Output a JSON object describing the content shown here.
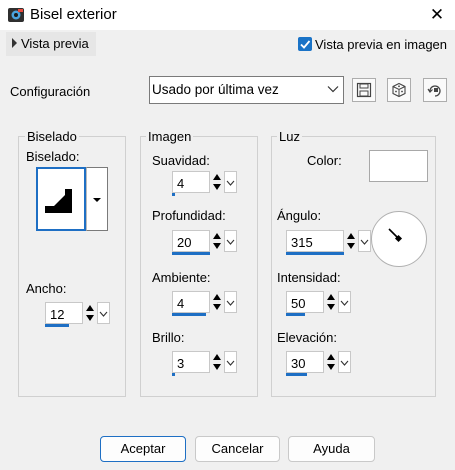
{
  "window": {
    "title": "Bisel exterior",
    "close_glyph": "✕"
  },
  "header": {
    "preview_toggle_label": "Vista previa",
    "preview_in_image_label": "Vista previa en imagen",
    "preview_in_image_checked": true
  },
  "config": {
    "label": "Configuración",
    "preset_value": "Usado por última vez"
  },
  "bevel": {
    "legend": "Biselado",
    "bevel_label": "Biselado:",
    "width_label": "Ancho:",
    "width_value": "12"
  },
  "image": {
    "legend": "Imagen",
    "smoothness_label": "Suavidad:",
    "smoothness_value": "4",
    "depth_label": "Profundidad:",
    "depth_value": "20",
    "ambience_label": "Ambiente:",
    "ambience_value": "4",
    "shininess_label": "Brillo:",
    "shininess_value": "3"
  },
  "light": {
    "legend": "Luz",
    "color_label": "Color:",
    "color_value": "#ffffff",
    "angle_label": "Ángulo:",
    "angle_value": "315",
    "intensity_label": "Intensidad:",
    "intensity_value": "50",
    "elevation_label": "Elevación:",
    "elevation_value": "30"
  },
  "footer": {
    "ok_label": "Aceptar",
    "cancel_label": "Cancelar",
    "help_label": "Ayuda"
  },
  "colors": {
    "accent": "#1e6fc4",
    "checkbox": "#1a73c7"
  },
  "icons": [
    "app-icon",
    "close-icon",
    "chevron-right-icon",
    "checkmark-icon",
    "chevron-down-icon",
    "save-icon",
    "dice-icon",
    "reset-icon"
  ]
}
